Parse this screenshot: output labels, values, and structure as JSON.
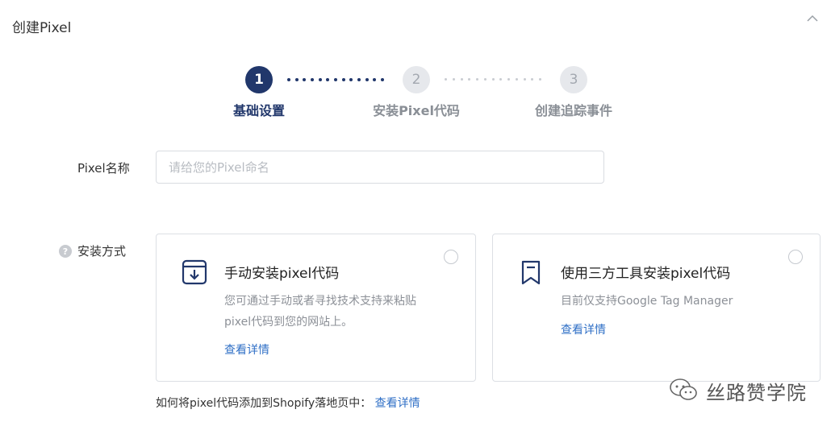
{
  "header": {
    "title": "创建Pixel",
    "collapse_icon": "chevron-up-icon"
  },
  "stepper": {
    "steps": [
      {
        "number": "1",
        "label": "基础设置",
        "state": "active"
      },
      {
        "number": "2",
        "label": "安装Pixel代码",
        "state": "inactive"
      },
      {
        "number": "3",
        "label": "创建追踪事件",
        "state": "inactive"
      }
    ],
    "active_color": "#21376b",
    "inactive_color": "#a3a8b0"
  },
  "form": {
    "name_label": "Pixel名称",
    "name_placeholder": "请给您的Pixel命名",
    "name_value": "",
    "install_label": "安装方式",
    "install_help_icon": "question-circle-icon"
  },
  "options": {
    "manual": {
      "icon": "download-box-icon",
      "title": "手动安装pixel代码",
      "desc_line1": "您可通过手动或者寻找技术支持来粘贴",
      "desc_line2": "pixel代码到您的网站上。",
      "link": "查看详情",
      "selected": false
    },
    "third_party": {
      "icon": "bookmark-icon",
      "title": "使用三方工具安装pixel代码",
      "desc_line1": "目前仅支持Google Tag Manager",
      "link": "查看详情",
      "selected": false
    }
  },
  "footer": {
    "note": "如何将pixel代码添加到Shopify落地页中：",
    "link": "查看详情"
  },
  "watermark": {
    "text": "丝路赞学院",
    "icon": "wechat-icon"
  },
  "colors": {
    "brand": "#21376b",
    "link": "#2f6fc6"
  }
}
